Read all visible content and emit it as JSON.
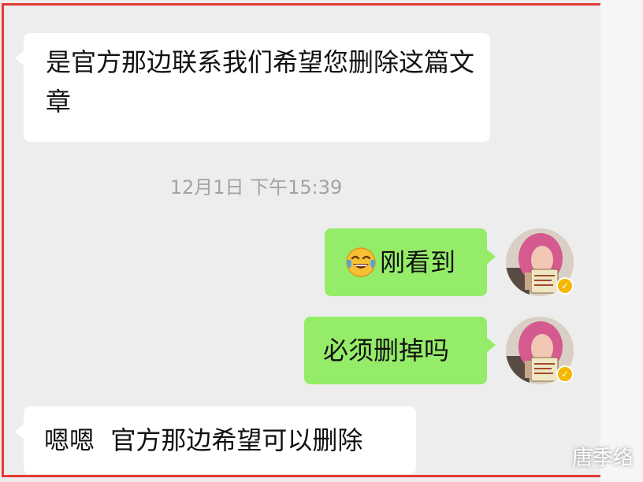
{
  "messages": [
    {
      "side": "left",
      "text": "是官方那边联系我们希望您删除这篇文章"
    },
    {
      "side": "right",
      "emoji": "face-with-tears-of-joy-icon",
      "text": "刚看到"
    },
    {
      "side": "right",
      "text": "必须删掉吗"
    },
    {
      "side": "left",
      "text": "嗯嗯  官方那边希望可以删除"
    }
  ],
  "timestamp": "12月1日  下午15:39",
  "watermark": "唐季络",
  "colors": {
    "incoming_bubble": "#ffffff",
    "outgoing_bubble": "#95ec69",
    "background": "#ededed",
    "frame": "#e53935",
    "verified_badge": "#f5b700"
  }
}
